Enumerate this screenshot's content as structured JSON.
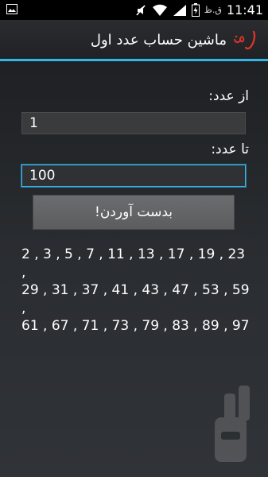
{
  "statusbar": {
    "ampm": "ق.ظ",
    "time": "11:41",
    "icons": [
      "image-icon",
      "mute-icon",
      "wifi-icon",
      "signal-icon",
      "battery-icon"
    ]
  },
  "actionbar": {
    "title": "ماشین حساب عدد اول",
    "logo_text": "عدل"
  },
  "form": {
    "from_label": "از عدد:",
    "from_value": "1",
    "to_label": "تا عدد:",
    "to_value": "100",
    "submit_label": "بدست آوردن!"
  },
  "result": {
    "text": "2 , 3 , 5 , 7 , 11 , 13 , 17 , 19 , 23 ,\n29 , 31 , 37 , 41 , 43 , 47 , 53 , 59 ,\n61 , 67 , 71 , 73 , 79 , 83 , 89 , 97"
  },
  "colors": {
    "accent": "#33b5e5",
    "logo_red": "#d9342b"
  }
}
